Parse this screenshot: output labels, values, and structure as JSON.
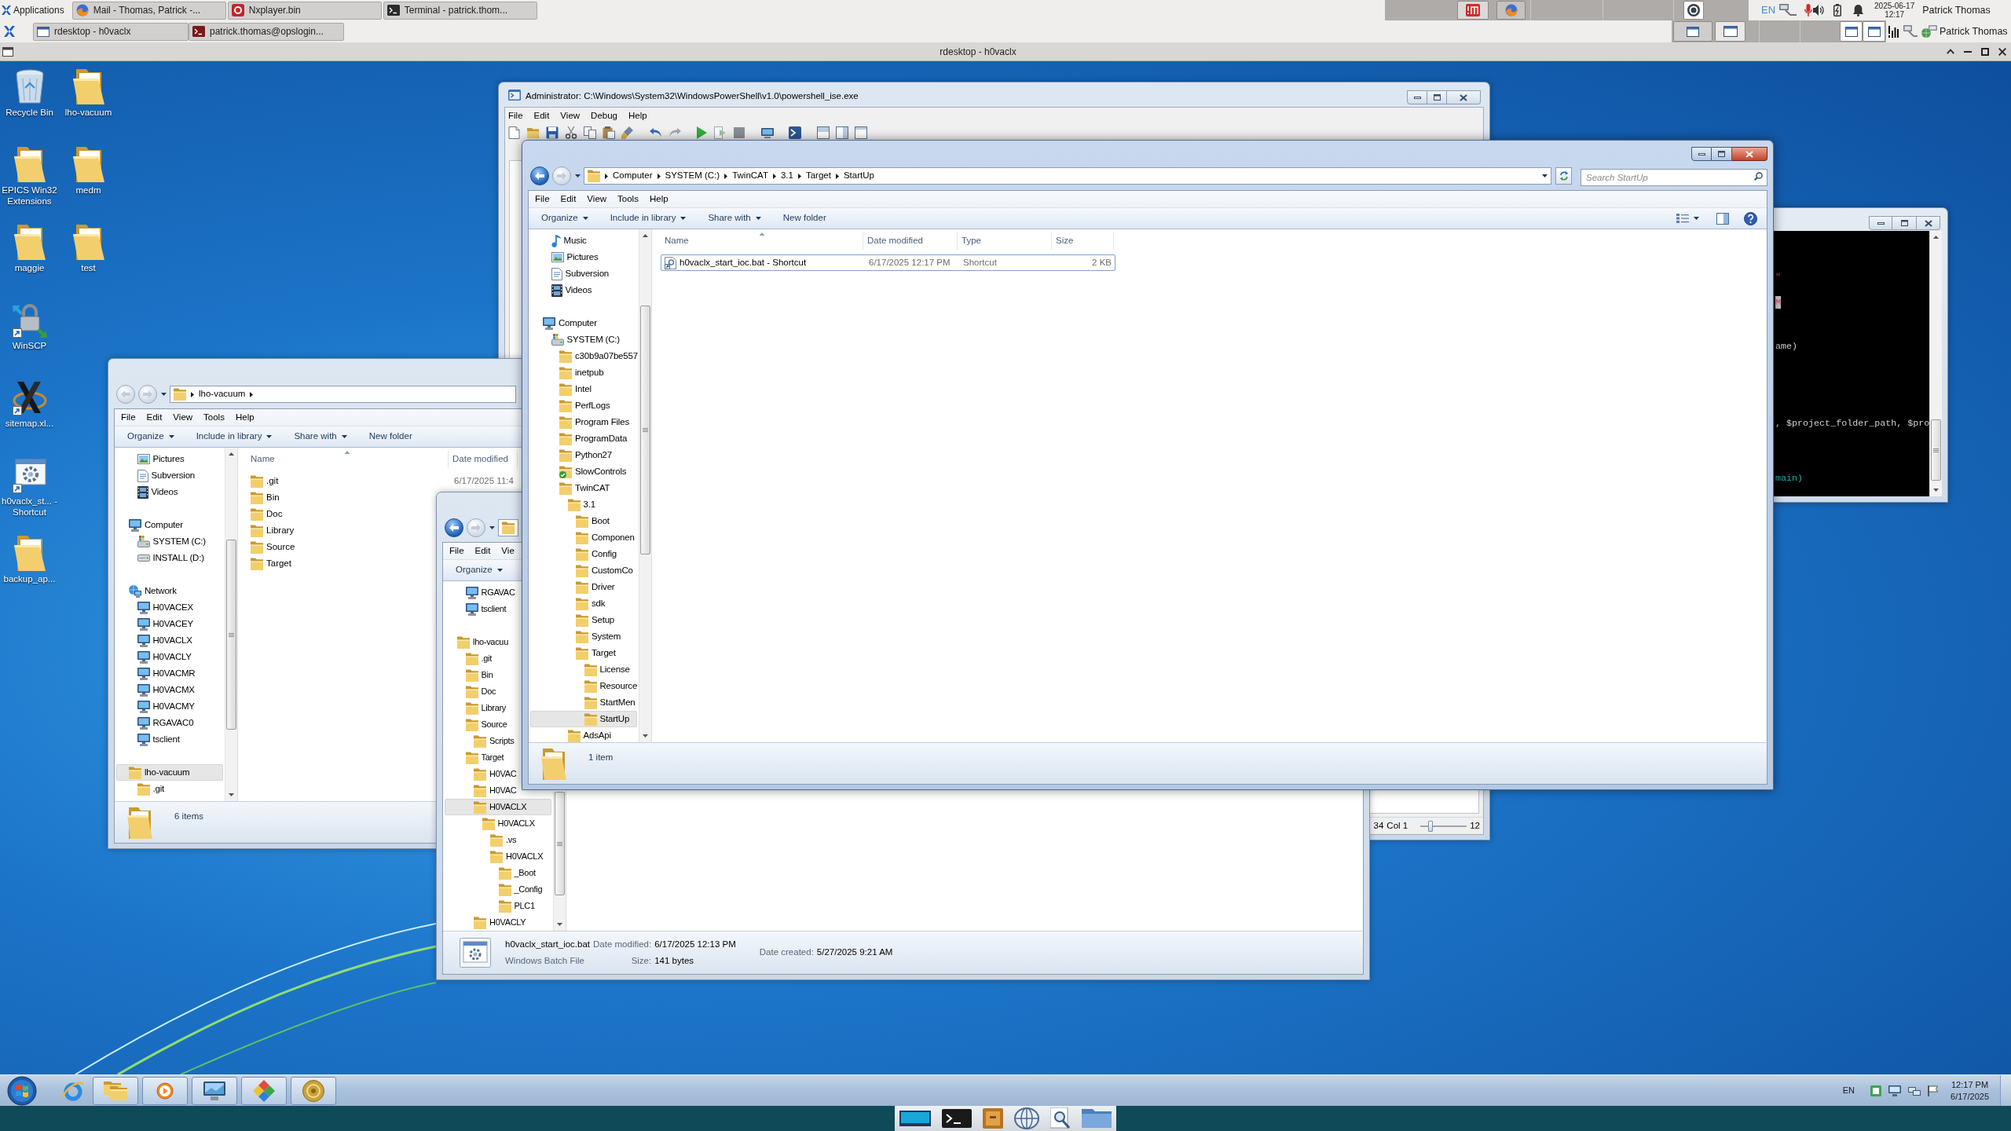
{
  "top_panel": {
    "applications_menu": "Applications",
    "tasks": [
      {
        "kind": "browser",
        "label": "Mail - Thomas, Patrick -..."
      },
      {
        "kind": "player",
        "label": "Nxplayer.bin"
      },
      {
        "kind": "terminal",
        "label": "Terminal - patrick.thom..."
      }
    ],
    "tasks_row_2": [
      {
        "kind": "remote",
        "label": "rdesktop - h0vaclx"
      },
      {
        "kind": "ssh",
        "label": "patrick.thomas@opslogin..."
      }
    ],
    "keyboard_layout": "EN",
    "date": "2025-06-17",
    "time": "12:17",
    "user": "Patrick Thomas",
    "user_row_2": "Patrick Thomas"
  },
  "rdesktop_window": {
    "title": "rdesktop - h0vaclx"
  },
  "desktop_icons": {
    "column_1": [
      {
        "kind": "recycle-bin",
        "label": "Recycle Bin"
      },
      {
        "kind": "folder",
        "label": "EPICS Win32 Extensions"
      },
      {
        "kind": "folder",
        "label": "maggie"
      },
      {
        "kind": "winscp",
        "label": "WinSCP"
      },
      {
        "kind": "xlaunch",
        "label": "sitemap.xl..."
      },
      {
        "kind": "batch-shortcut",
        "label": "h0vaclx_st... - Shortcut"
      },
      {
        "kind": "folder",
        "label": "backup_ap..."
      }
    ],
    "column_2": [
      {
        "kind": "folder",
        "label": "lho-vacuum"
      },
      {
        "kind": "folder",
        "label": "medm"
      },
      {
        "kind": "folder",
        "label": "test"
      }
    ]
  },
  "powershell_ise": {
    "active": false,
    "title": "Administrator: C:\\Windows\\System32\\WindowsPowerShell\\v1.0\\powershell_ise.exe",
    "menu": [
      "File",
      "Edit",
      "View",
      "Debug",
      "Help"
    ],
    "status": {
      "line": "34",
      "column": "Col 1",
      "zoom_slider": {
        "level": 0.22
      },
      "zoom": "12"
    }
  },
  "folder_window_lho_vacuum": {
    "active": false,
    "back_enabled": false,
    "forward_enabled": false,
    "breadcrumbs": [
      "lho-vacuum"
    ],
    "trailing_arrow": true,
    "menu": [
      "File",
      "Edit",
      "View",
      "Tools",
      "Help"
    ],
    "toolbar": [
      {
        "label": "Organize",
        "dropdown": true
      },
      {
        "label": "Include in library",
        "dropdown": true
      },
      {
        "label": "Share with",
        "dropdown": true
      },
      {
        "label": "New folder",
        "dropdown": false
      }
    ],
    "nav_groups": [
      {
        "items": [
          {
            "children": [
              {
                "kind": "pictures",
                "label": "Pictures",
                "selected": false
              },
              {
                "kind": "document",
                "label": "Subversion",
                "selected": false
              },
              {
                "kind": "videos",
                "label": "Videos",
                "selected": false
              }
            ]
          }
        ]
      },
      {
        "items": [
          {
            "kind": "computer",
            "label": "Computer",
            "selected": false,
            "children": [
              {
                "kind": "system-drive",
                "label": "SYSTEM (C:)",
                "selected": false
              },
              {
                "kind": "drive",
                "label": "INSTALL (D:)",
                "selected": false
              }
            ]
          }
        ]
      },
      {
        "items": [
          {
            "kind": "network",
            "label": "Network",
            "selected": false,
            "children": [
              {
                "kind": "pc",
                "label": "H0VACEX",
                "selected": false
              },
              {
                "kind": "pc",
                "label": "H0VACEY",
                "selected": false
              },
              {
                "kind": "pc",
                "label": "H0VACLX",
                "selected": false
              },
              {
                "kind": "pc",
                "label": "H0VACLY",
                "selected": false
              },
              {
                "kind": "pc",
                "label": "H0VACMR",
                "selected": false
              },
              {
                "kind": "pc",
                "label": "H0VACMX",
                "selected": false
              },
              {
                "kind": "pc",
                "label": "H0VACMY",
                "selected": false
              },
              {
                "kind": "pc",
                "label": "RGAVAC0",
                "selected": false
              },
              {
                "kind": "pc",
                "label": "tsclient",
                "selected": false
              }
            ]
          }
        ]
      },
      {
        "items": [
          {
            "kind": "folder",
            "label": "lho-vacuum",
            "selected": true,
            "children": [
              {
                "kind": "folder",
                "label": ".git",
                "selected": false
              }
            ]
          }
        ]
      }
    ],
    "columns": [
      {
        "label": "Name",
        "sorted": true
      },
      {
        "label": "Date modified",
        "sorted": false
      }
    ],
    "files": [
      {
        "kind": "folder",
        "name": ".git",
        "date_modified": "6/17/2025 11:4"
      },
      {
        "kind": "folder",
        "name": "Bin"
      },
      {
        "kind": "folder",
        "name": "Doc"
      },
      {
        "kind": "folder",
        "name": "Library"
      },
      {
        "kind": "folder",
        "name": "Source"
      },
      {
        "kind": "folder",
        "name": "Target"
      }
    ],
    "status": "6 items"
  },
  "folder_window_h0vaclx": {
    "active": false,
    "back_enabled": true,
    "forward_enabled": false,
    "menu": [
      "File",
      "Edit",
      "Vie"
    ],
    "toolbar": [
      {
        "label": "Organize",
        "dropdown": true
      }
    ],
    "nav_groups": [
      {
        "items": [
          {
            "children": [
              {
                "kind": "pc",
                "label": "RGAVAC",
                "selected": false
              },
              {
                "kind": "pc",
                "label": "tsclient",
                "selected": false
              }
            ]
          }
        ]
      },
      {
        "items": [
          {
            "kind": "folder",
            "label": "lho-vacuu",
            "selected": false,
            "children": [
              {
                "kind": "folder",
                "label": ".git",
                "selected": false
              },
              {
                "kind": "folder",
                "label": "Bin",
                "selected": false
              },
              {
                "kind": "folder",
                "label": "Doc",
                "selected": false
              },
              {
                "kind": "folder",
                "label": "Library",
                "selected": false
              },
              {
                "kind": "folder",
                "label": "Source",
                "selected": false,
                "children": [
                  {
                    "kind": "folder",
                    "label": "Scripts",
                    "selected": false
                  }
                ]
              },
              {
                "kind": "folder",
                "label": "Target",
                "selected": false,
                "children": [
                  {
                    "kind": "folder",
                    "label": "H0VAC",
                    "selected": false
                  },
                  {
                    "kind": "folder",
                    "label": "H0VAC",
                    "selected": false
                  },
                  {
                    "kind": "folder",
                    "label": "H0VACLX",
                    "selected": true,
                    "children": [
                      {
                        "kind": "folder",
                        "label": "H0VACLX",
                        "selected": false,
                        "children": [
                          {
                            "kind": "folder",
                            "label": ".vs",
                            "selected": false
                          },
                          {
                            "kind": "folder",
                            "label": "H0VACLX",
                            "selected": false,
                            "children": [
                              {
                                "kind": "folder",
                                "label": "_Boot",
                                "selected": false
                              },
                              {
                                "kind": "folder",
                                "label": "_Config",
                                "selected": false
                              },
                              {
                                "kind": "folder",
                                "label": "PLC1",
                                "selected": false
                              }
                            ]
                          }
                        ]
                      }
                    ]
                  },
                  {
                    "kind": "folder",
                    "label": "H0VACLY",
                    "selected": false
                  }
                ]
              }
            ]
          }
        ]
      }
    ],
    "details": {
      "file_name": "h0vaclx_start_ioc.bat",
      "file_type": "Windows Batch File",
      "property_columns": [
        [
          {
            "label": "Date modified:",
            "value": "6/17/2025 12:13 PM"
          },
          {
            "label": "Size:",
            "value": "141 bytes"
          }
        ],
        [
          {
            "label": "Date created:",
            "value": "5/27/2025 9:21 AM"
          }
        ]
      ]
    }
  },
  "console_window": {
    "active": false,
    "lines": [
      {
        "kind": "string",
        "text": "\""
      },
      {
        "kind": "highlighted",
        "text": "M"
      },
      {
        "kind": "plain",
        "text": "ame)"
      },
      {
        "kind": "plain",
        "text": ", $project_folder_path, $pro"
      },
      {
        "kind": "function",
        "text": "main)"
      }
    ]
  },
  "folder_window_startup": {
    "active": true,
    "back_enabled": true,
    "forward_enabled": false,
    "breadcrumbs": [
      "Computer",
      "SYSTEM (C:)",
      "TwinCAT",
      "3.1",
      "Target",
      "StartUp"
    ],
    "search_placeholder": "Search StartUp",
    "menu": [
      "File",
      "Edit",
      "View",
      "Tools",
      "Help"
    ],
    "toolbar": [
      {
        "label": "Organize",
        "dropdown": true
      },
      {
        "label": "Include in library",
        "dropdown": true
      },
      {
        "label": "Share with",
        "dropdown": true
      },
      {
        "label": "New folder",
        "dropdown": false
      }
    ],
    "nav_groups": [
      {
        "items": [
          {
            "children": [
              {
                "kind": "music",
                "label": "Music",
                "selected": false
              },
              {
                "kind": "pictures",
                "label": "Pictures",
                "selected": false
              },
              {
                "kind": "document",
                "label": "Subversion",
                "selected": false
              },
              {
                "kind": "videos",
                "label": "Videos",
                "selected": false
              }
            ]
          }
        ]
      },
      {
        "items": [
          {
            "kind": "computer",
            "label": "Computer",
            "selected": false,
            "children": [
              {
                "kind": "system-drive",
                "label": "SYSTEM (C:)",
                "selected": false,
                "children": [
                  {
                    "kind": "folder",
                    "label": "c30b9a07be557",
                    "selected": false
                  },
                  {
                    "kind": "folder",
                    "label": "inetpub",
                    "selected": false
                  },
                  {
                    "kind": "folder",
                    "label": "Intel",
                    "selected": false
                  },
                  {
                    "kind": "folder",
                    "label": "PerfLogs",
                    "selected": false
                  },
                  {
                    "kind": "folder",
                    "label": "Program Files",
                    "selected": false
                  },
                  {
                    "kind": "folder",
                    "label": "ProgramData",
                    "selected": false
                  },
                  {
                    "kind": "folder",
                    "label": "Python27",
                    "selected": false
                  },
                  {
                    "kind": "folder-check",
                    "label": "SlowControls",
                    "selected": false
                  },
                  {
                    "kind": "folder",
                    "label": "TwinCAT",
                    "selected": false,
                    "children": [
                      {
                        "kind": "folder",
                        "label": "3.1",
                        "selected": false,
                        "children": [
                          {
                            "kind": "folder",
                            "label": "Boot",
                            "selected": false
                          },
                          {
                            "kind": "folder",
                            "label": "Componen",
                            "selected": false
                          },
                          {
                            "kind": "folder",
                            "label": "Config",
                            "selected": false
                          },
                          {
                            "kind": "folder",
                            "label": "CustomCo",
                            "selected": false
                          },
                          {
                            "kind": "folder",
                            "label": "Driver",
                            "selected": false
                          },
                          {
                            "kind": "folder",
                            "label": "sdk",
                            "selected": false
                          },
                          {
                            "kind": "folder",
                            "label": "Setup",
                            "selected": false
                          },
                          {
                            "kind": "folder",
                            "label": "System",
                            "selected": false
                          },
                          {
                            "kind": "folder",
                            "label": "Target",
                            "selected": false,
                            "children": [
                              {
                                "kind": "folder",
                                "label": "License",
                                "selected": false
                              },
                              {
                                "kind": "folder",
                                "label": "Resource",
                                "selected": false
                              },
                              {
                                "kind": "folder",
                                "label": "StartMen",
                                "selected": false
                              },
                              {
                                "kind": "folder",
                                "label": "StartUp",
                                "selected": true
                              }
                            ]
                          }
                        ]
                      },
                      {
                        "kind": "folder",
                        "label": "AdsApi",
                        "selected": false
                      }
                    ]
                  }
                ]
              }
            ]
          }
        ]
      }
    ],
    "columns": [
      {
        "label": "Name",
        "sorted": true
      },
      {
        "label": "Date modified",
        "sorted": false
      },
      {
        "label": "Type",
        "sorted": false
      },
      {
        "label": "Size",
        "sorted": false
      }
    ],
    "files": [
      {
        "kind": "shortcut",
        "name": "h0vaclx_start_ioc.bat - Shortcut",
        "date_modified": "6/17/2025 12:17 PM",
        "type": "Shortcut",
        "size": "2 KB",
        "focused": true
      }
    ],
    "status": "1 item"
  },
  "taskbar": {
    "items": [
      {
        "kind": "ie",
        "running": false
      },
      {
        "kind": "explorer",
        "running": true
      },
      {
        "kind": "media-player",
        "running": true
      },
      {
        "kind": "remote-desktop",
        "running": true
      },
      {
        "kind": "color-app",
        "running": true
      },
      {
        "kind": "disc-app",
        "running": true
      }
    ],
    "language": "EN",
    "time": "12:17 PM",
    "date": "6/17/2025"
  }
}
